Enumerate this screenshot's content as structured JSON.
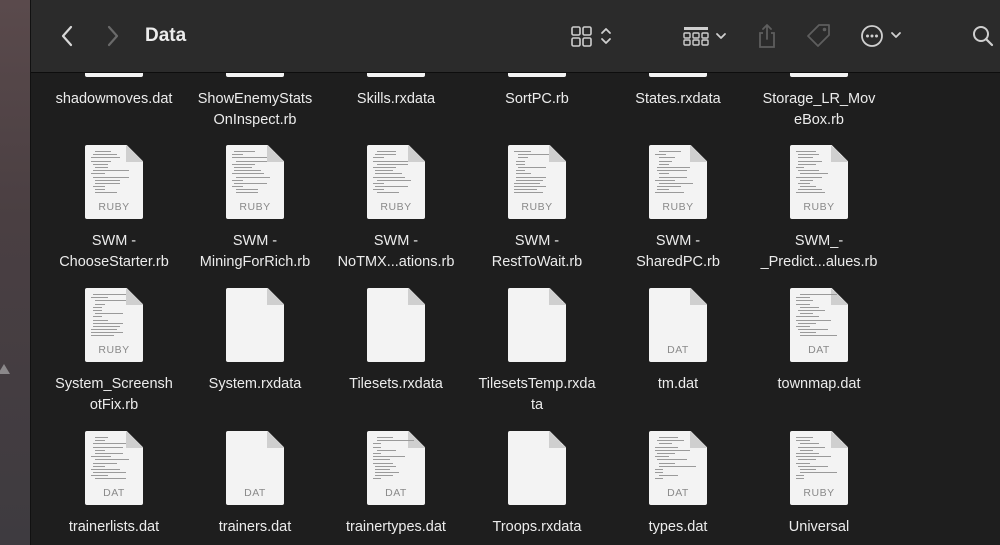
{
  "window": {
    "title": "Data",
    "colors": {
      "toolbar": "#2b2b2b",
      "background": "#1e1e1e",
      "text": "#ececec"
    },
    "icons": [
      "chevron-left-icon",
      "chevron-right-icon",
      "grid-view-icon",
      "group-icon",
      "share-icon",
      "tag-icon",
      "ellipsis-circle-icon",
      "search-icon"
    ]
  },
  "rows": [
    {
      "items": [
        {
          "name": "shadowmoves.dat",
          "badge": "",
          "preview": false
        },
        {
          "name": "ShowEnemyStats\nOnInspect.rb",
          "badge": "",
          "preview": false
        },
        {
          "name": "Skills.rxdata",
          "badge": "",
          "preview": false
        },
        {
          "name": "SortPC.rb",
          "badge": "",
          "preview": false
        },
        {
          "name": "States.rxdata",
          "badge": "",
          "preview": false
        },
        {
          "name": "Storage_LR_Mov\neBox.rb",
          "badge": "",
          "preview": false
        }
      ]
    },
    {
      "items": [
        {
          "name": "SWM -\nChooseStarter.rb",
          "badge": "RUBY",
          "preview": true
        },
        {
          "name": "SWM -\nMiningForRich.rb",
          "badge": "RUBY",
          "preview": true
        },
        {
          "name": "SWM -\nNoTMX...ations.rb",
          "badge": "RUBY",
          "preview": true
        },
        {
          "name": "SWM -\nRestToWait.rb",
          "badge": "RUBY",
          "preview": true
        },
        {
          "name": "SWM -\nSharedPC.rb",
          "badge": "RUBY",
          "preview": true
        },
        {
          "name": "SWM_-\n_Predict...alues.rb",
          "badge": "RUBY",
          "preview": true
        }
      ]
    },
    {
      "items": [
        {
          "name": "System_Screensh\notFix.rb",
          "badge": "RUBY",
          "preview": true
        },
        {
          "name": "System.rxdata",
          "badge": "",
          "preview": false
        },
        {
          "name": "Tilesets.rxdata",
          "badge": "",
          "preview": false
        },
        {
          "name": "TilesetsTemp.rxda\nta",
          "badge": "",
          "preview": false
        },
        {
          "name": "tm.dat",
          "badge": "DAT",
          "preview": false
        },
        {
          "name": "townmap.dat",
          "badge": "DAT",
          "preview": true
        }
      ]
    },
    {
      "items": [
        {
          "name": "trainerlists.dat",
          "badge": "DAT",
          "preview": true
        },
        {
          "name": "trainers.dat",
          "badge": "DAT",
          "preview": false
        },
        {
          "name": "trainertypes.dat",
          "badge": "DAT",
          "preview": true
        },
        {
          "name": "Troops.rxdata",
          "badge": "",
          "preview": false
        },
        {
          "name": "types.dat",
          "badge": "DAT",
          "preview": true
        },
        {
          "name": "Universal",
          "badge": "RUBY",
          "preview": true
        }
      ]
    }
  ]
}
